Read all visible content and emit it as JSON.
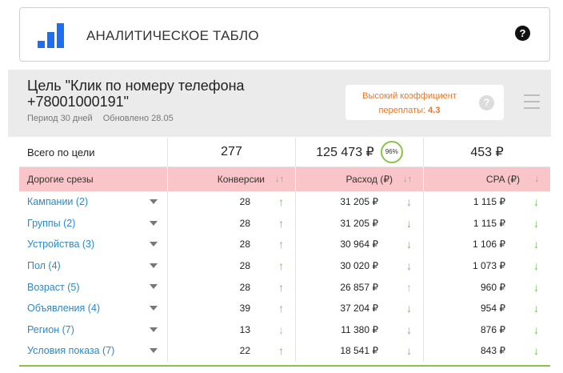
{
  "header": {
    "title": "АНАЛИТИЧЕСКОЕ ТАБЛО",
    "help_symbol": "?",
    "logo_icon": "bar-chart-icon",
    "logo_color": "#1e6ff0"
  },
  "goal": {
    "title": "Цель \"Клик по номеру телефона +78001000191\"",
    "period": "Период 30 дней",
    "updated": "Обновлено 28.05",
    "overpay_label": "Высокий коэффициент переплаты:",
    "overpay_value": "4.3",
    "overpay_help": "?",
    "accent_color": "#e8772a"
  },
  "totals": {
    "label": "Всего по цели",
    "conversions": "277",
    "spend": "125 473 ₽",
    "spend_share": "96%",
    "cpa": "453 ₽"
  },
  "columns": {
    "slice": "Дорогие срезы",
    "conversions": "Конверсии",
    "spend": "Расход (₽)",
    "cpa": "CPA (₽)",
    "sort_both": "↓↑",
    "sort_down": "↓"
  },
  "rows": [
    {
      "label": "Кампании (2)",
      "conv": "28",
      "conv_dir": "up",
      "spend": "31 205 ₽",
      "spend_dir": "down",
      "cpa": "1 115 ₽",
      "cpa_dir": "down"
    },
    {
      "label": "Группы (2)",
      "conv": "28",
      "conv_dir": "up",
      "spend": "31 205 ₽",
      "spend_dir": "down",
      "cpa": "1 115 ₽",
      "cpa_dir": "down"
    },
    {
      "label": "Устройства (3)",
      "conv": "28",
      "conv_dir": "up",
      "spend": "30 964 ₽",
      "spend_dir": "down",
      "cpa": "1 106 ₽",
      "cpa_dir": "down"
    },
    {
      "label": "Пол (4)",
      "conv": "28",
      "conv_dir": "up",
      "spend": "30 020 ₽",
      "spend_dir": "down",
      "cpa": "1 073 ₽",
      "cpa_dir": "down"
    },
    {
      "label": "Возраст (5)",
      "conv": "28",
      "conv_dir": "up",
      "spend": "26 857 ₽",
      "spend_dir": "up-red",
      "cpa": "960 ₽",
      "cpa_dir": "down"
    },
    {
      "label": "Объявления (4)",
      "conv": "39",
      "conv_dir": "up",
      "spend": "37 204 ₽",
      "spend_dir": "down",
      "cpa": "954 ₽",
      "cpa_dir": "down"
    },
    {
      "label": "Регион (7)",
      "conv": "13",
      "conv_dir": "down-red",
      "spend": "11 380 ₽",
      "spend_dir": "down",
      "cpa": "876 ₽",
      "cpa_dir": "down"
    },
    {
      "label": "Условия показа (7)",
      "conv": "22",
      "conv_dir": "up",
      "spend": "18 541 ₽",
      "spend_dir": "down",
      "cpa": "843 ₽",
      "cpa_dir": "down"
    }
  ],
  "colors": {
    "header_row": "#f9c5c8",
    "link": "#2b89c8",
    "good": "#6cc34a",
    "bad": "#f4a0a8"
  }
}
